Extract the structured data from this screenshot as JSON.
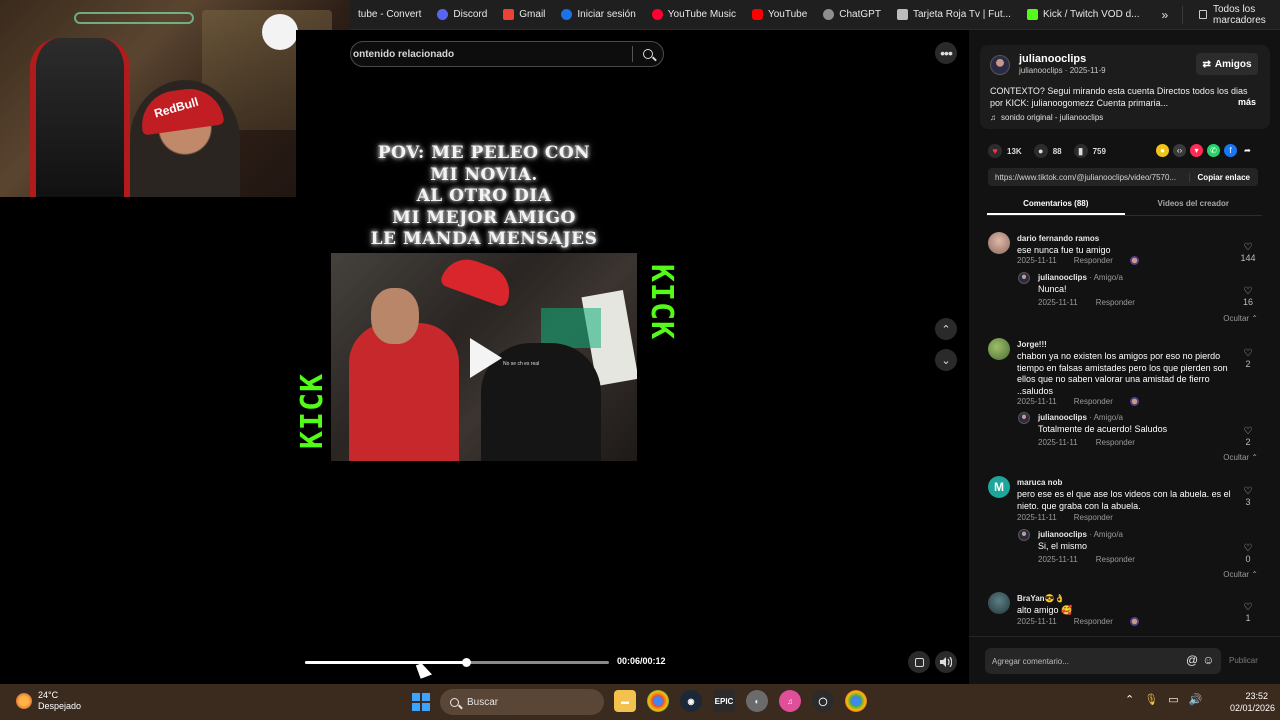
{
  "bookmarks": {
    "items": [
      {
        "label": "tube - Convert",
        "color": "#1f1f1f"
      },
      {
        "label": "Discord",
        "color": "#5865f2"
      },
      {
        "label": "Gmail",
        "color": "#ea4335"
      },
      {
        "label": "Iniciar sesión",
        "color": "#1a73e8"
      },
      {
        "label": "YouTube Music",
        "color": "#ff0033"
      },
      {
        "label": "YouTube",
        "color": "#ff0000"
      },
      {
        "label": "ChatGPT",
        "color": "#8e8e8e"
      },
      {
        "label": "Tarjeta Roja Tv | Fut...",
        "color": "#bdbdbd"
      },
      {
        "label": "Kick / Twitch VOD d...",
        "color": "#53fc18"
      }
    ],
    "more": "»",
    "all_bookmarks": "Todos los marcadores"
  },
  "webcam": {
    "cap_text": "RedBull"
  },
  "player": {
    "search_placeholder": "ontenido relacionado",
    "caption_lines": [
      "POV: ME PELEO CON",
      "MI NOVIA.",
      "AL OTRO DIA",
      "MI MEJOR AMIGO",
      "LE MANDA MENSAJES"
    ],
    "watermark": "KICK",
    "progress": 0.53,
    "time": "00:06/00:12",
    "clip_overlay": "No se ch es real"
  },
  "side_controls": {
    "more": "•••",
    "up": "⌃",
    "down": "⌄"
  },
  "author": {
    "name": "julianooclips",
    "handle_date": "julianooclips · 2025-11-9",
    "follow_label": "Amigos",
    "description": "CONTEXTO? Segui mirando esta cuenta Directos todos los dias por KICK: julianoogomezz Cuenta primaria...",
    "more": "más",
    "sound": "sonido original - julianooclips"
  },
  "stats": {
    "likes": "13K",
    "comments": "88",
    "saves": "759"
  },
  "share": {
    "url": "https://www.tiktok.com/@julianooclips/video/7570...",
    "copy_label": "Copiar enlace"
  },
  "tabs": [
    {
      "label": "Comentarios (88)",
      "active": true
    },
    {
      "label": "Videos del creador",
      "active": false
    }
  ],
  "comments": [
    {
      "name": "dario fernando ramos",
      "text": "ese nunca fue tu amigo",
      "date": "2025-11-11",
      "reply_label": "Responder",
      "likes": "144",
      "reply": {
        "name": "julianooclips",
        "tag": " · Amigo/a",
        "text": "Nunca!",
        "date": "2025-11-11",
        "reply_label": "Responder",
        "likes": "16"
      },
      "hide_label": "Ocultar ⌃"
    },
    {
      "name": "Jorge!!!",
      "text": "chabon ya no existen los amigos por eso no pierdo tiempo en falsas amistades pero los que pierden son ellos que no saben valorar una amistad de fierro ..saludos",
      "date": "2025-11-11",
      "reply_label": "Responder",
      "likes": "2",
      "reply": {
        "name": "julianooclips",
        "tag": " · Amigo/a",
        "text": "Totalmente de acuerdo! Saludos",
        "date": "2025-11-11",
        "reply_label": "Responder",
        "likes": "2"
      },
      "hide_label": "Ocultar ⌃"
    },
    {
      "name": "maruca nob",
      "avatar_letter": "M",
      "text": "pero ese es el que ase los videos con la abuela. es el nieto. que graba con la abuela.",
      "date": "2025-11-11",
      "reply_label": "Responder",
      "likes": "3",
      "reply": {
        "name": "julianooclips",
        "tag": " · Amigo/a",
        "text": "Si, el mismo",
        "date": "2025-11-11",
        "reply_label": "Responder",
        "likes": "0"
      },
      "hide_label": "Ocultar ⌃"
    },
    {
      "name": "BraYan😎👌",
      "text": "alto amigo 🥰",
      "date": "2025-11-11",
      "reply_label": "Responder",
      "likes": "1"
    }
  ],
  "add_comment": {
    "placeholder": "Agregar comentario...",
    "mention": "@",
    "emoji": "☺",
    "publish": "Publicar"
  },
  "taskbar": {
    "temp": "24°C",
    "weather": "Despejado",
    "search": "Buscar",
    "time": "23:52",
    "date": "02/01/2026",
    "apps": [
      {
        "name": "Explorer",
        "color": "#f2c14e"
      },
      {
        "name": "Chrome",
        "color": "#1a73e8"
      },
      {
        "name": "Steam",
        "color": "#1b2838"
      },
      {
        "name": "Epic",
        "color": "#2b2b2b"
      },
      {
        "name": "Valorant",
        "color": "#6b6b6b"
      },
      {
        "name": "iTunes",
        "color": "#e04f9a"
      },
      {
        "name": "Opera",
        "color": "#2b2b2b"
      },
      {
        "name": "Chrome Dev",
        "color": "#34a853"
      }
    ]
  }
}
